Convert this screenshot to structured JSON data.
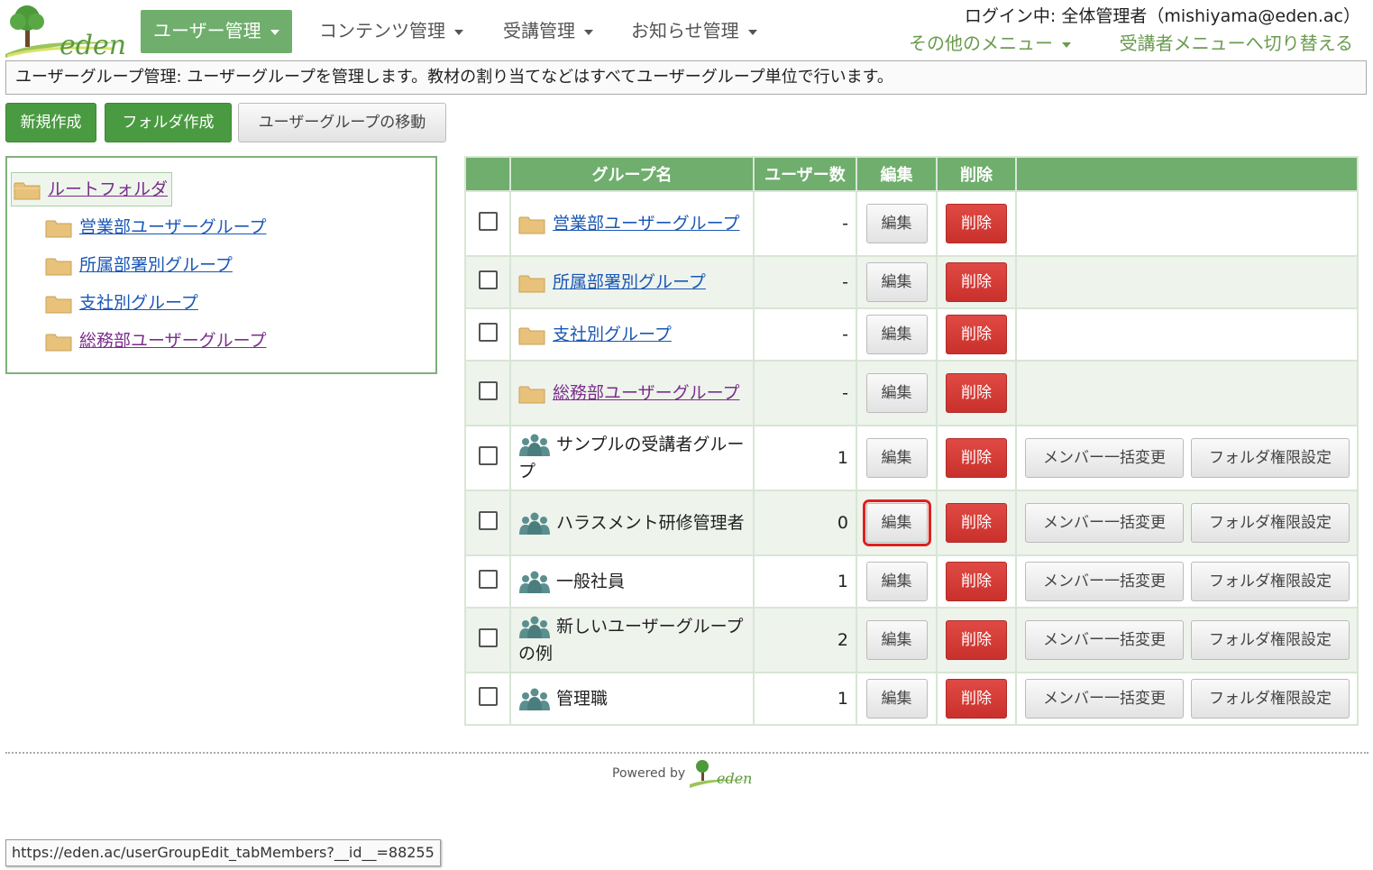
{
  "brand": {
    "logo_text": "eden"
  },
  "nav": {
    "items": [
      {
        "label": "ユーザー管理",
        "active": true
      },
      {
        "label": "コンテンツ管理",
        "active": false
      },
      {
        "label": "受講管理",
        "active": false
      },
      {
        "label": "お知らせ管理",
        "active": false
      }
    ],
    "login": "ログイン中: 全体管理者（mishiyama@eden.ac）",
    "other_menu": "その他のメニュー",
    "switch_menu": "受講者メニューへ切り替える"
  },
  "description": "ユーザーグループ管理: ユーザーグループを管理します。教材の割り当てなどはすべてユーザーグループ単位で行います。",
  "toolbar": {
    "new_label": "新規作成",
    "folder_label": "フォルダ作成",
    "move_label": "ユーザーグループの移動"
  },
  "tree": {
    "root": "ルートフォルダ",
    "children": [
      "営業部ユーザーグループ",
      "所属部署別グループ",
      "支社別グループ",
      "総務部ユーザーグループ"
    ]
  },
  "table": {
    "headers": {
      "name": "グループ名",
      "users": "ユーザー数",
      "edit": "編集",
      "delete": "削除"
    },
    "edit_label": "編集",
    "delete_label": "削除",
    "bulk_label": "メンバー一括変更",
    "perm_label": "フォルダ権限設定",
    "rows": [
      {
        "type": "folder",
        "name": "営業部ユーザーグループ",
        "count": "-"
      },
      {
        "type": "folder",
        "name": "所属部署別グループ",
        "count": "-"
      },
      {
        "type": "folder",
        "name": "支社別グループ",
        "count": "-"
      },
      {
        "type": "folder",
        "name": "総務部ユーザーグループ",
        "count": "-"
      },
      {
        "type": "group",
        "name": "サンプルの受講者グループ",
        "count": "1"
      },
      {
        "type": "group",
        "name": "ハラスメント研修管理者",
        "count": "0"
      },
      {
        "type": "group",
        "name": "一般社員",
        "count": "1"
      },
      {
        "type": "group",
        "name": "新しいユーザーグループの例",
        "count": "2"
      },
      {
        "type": "group",
        "name": "管理職",
        "count": "1"
      }
    ]
  },
  "footer": {
    "powered_by": "Powered by",
    "logo_text": "eden"
  },
  "status_url": "https://eden.ac/userGroupEdit_tabMembers?__id__=88255",
  "colors": {
    "accent_green": "#6fae6c",
    "button_green": "#4a9a42",
    "danger_red": "#c9302c",
    "link_blue": "#1a57b5",
    "visited_purple": "#7b2d8c"
  }
}
